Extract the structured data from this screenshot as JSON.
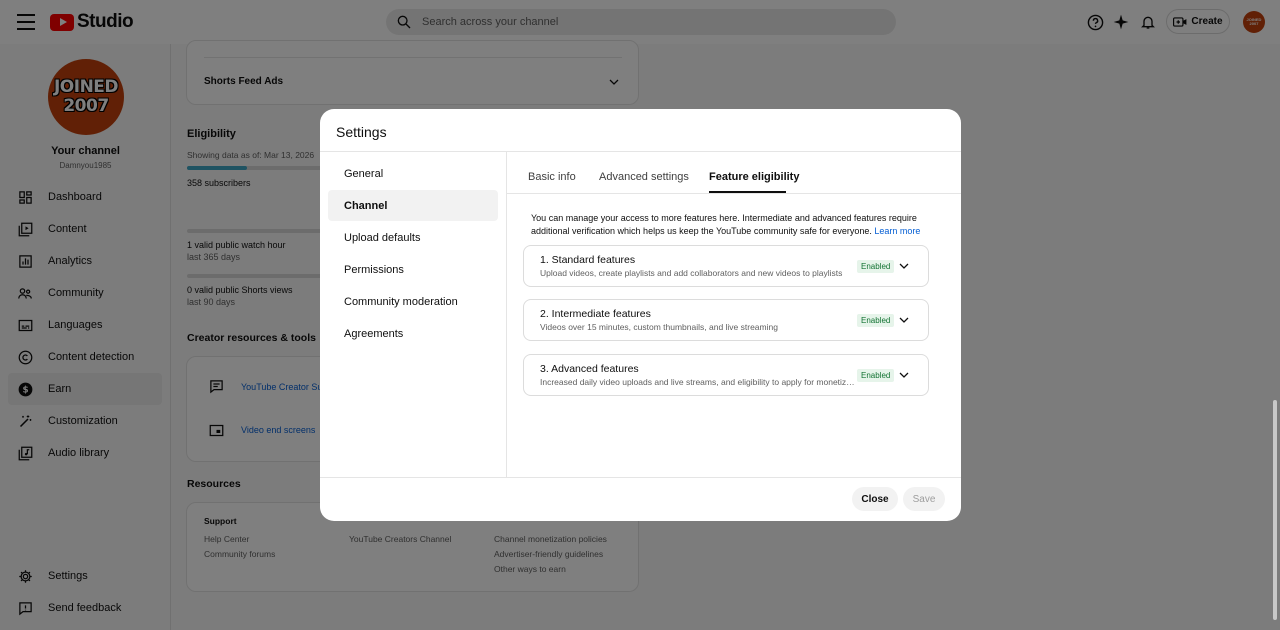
{
  "header": {
    "logo_text": "Studio",
    "search_placeholder": "Search across your channel",
    "create_label": "Create",
    "avatar_text": "JOINED 2007"
  },
  "sidebar": {
    "avatar_line1": "JOINED",
    "avatar_line2": "2007",
    "your_channel": "Your channel",
    "handle": "Damnyou1985",
    "items": [
      {
        "label": "Dashboard",
        "icon": "dashboard-icon"
      },
      {
        "label": "Content",
        "icon": "content-icon"
      },
      {
        "label": "Analytics",
        "icon": "analytics-icon"
      },
      {
        "label": "Community",
        "icon": "community-icon"
      },
      {
        "label": "Languages",
        "icon": "languages-icon"
      },
      {
        "label": "Content detection",
        "icon": "copyright-icon"
      },
      {
        "label": "Earn",
        "icon": "earn-icon"
      },
      {
        "label": "Customization",
        "icon": "customization-icon"
      },
      {
        "label": "Audio library",
        "icon": "audio-library-icon"
      }
    ],
    "bottom_items": [
      {
        "label": "Settings",
        "icon": "gear-icon"
      },
      {
        "label": "Send feedback",
        "icon": "feedback-icon"
      }
    ]
  },
  "background": {
    "shorts_feed_ads": "Shorts Feed Ads",
    "eligibility_title": "Eligibility",
    "showing_data": "Showing data as of: Mar 13, 2026",
    "subscribers": "358 subscribers",
    "subscribers_progress": 0.3,
    "watch_hours": "1 valid public watch hour",
    "watch_hours_period": "last 365 days",
    "shorts_views": "0 valid public Shorts views",
    "shorts_views_period": "last 90 days",
    "creator_resources_title": "Creator resources & tools",
    "creator_support": "YouTube Creator Sup",
    "video_end_screens": "Video end screens",
    "resources_title": "Resources",
    "support_title": "Support",
    "help_center": "Help Center",
    "community_forums": "Community forums",
    "creators_channel": "YouTube Creators Channel",
    "monetization_policies": "Channel monetization policies",
    "advertiser_guidelines": "Advertiser-friendly guidelines",
    "other_ways": "Other ways to earn"
  },
  "modal": {
    "title": "Settings",
    "nav": [
      {
        "label": "General",
        "active": false
      },
      {
        "label": "Channel",
        "active": true
      },
      {
        "label": "Upload defaults",
        "active": false
      },
      {
        "label": "Permissions",
        "active": false
      },
      {
        "label": "Community moderation",
        "active": false
      },
      {
        "label": "Agreements",
        "active": false
      }
    ],
    "tabs": [
      {
        "label": "Basic info",
        "active": false
      },
      {
        "label": "Advanced settings",
        "active": false
      },
      {
        "label": "Feature eligibility",
        "active": true
      }
    ],
    "description": "You can manage your access to more features here. Intermediate and advanced features require additional verification which helps us keep the YouTube community safe for everyone.",
    "learn_more": "Learn more",
    "features": [
      {
        "title": "1. Standard features",
        "subtitle": "Upload videos, create playlists and add collaborators and new videos to playlists",
        "status": "Enabled"
      },
      {
        "title": "2. Intermediate features",
        "subtitle": "Videos over 15 minutes, custom thumbnails, and live streaming",
        "status": "Enabled"
      },
      {
        "title": "3. Advanced features",
        "subtitle": "Increased daily video uploads and live streams, and eligibility to apply for monetization",
        "status": "Enabled"
      }
    ],
    "close_label": "Close",
    "save_label": "Save"
  },
  "colors": {
    "brand_red": "#ff0000",
    "avatar_orange": "#c2410c",
    "link_blue": "#065fd4",
    "enabled_green": "#137333",
    "enabled_bg": "#e6f4ea",
    "progress_teal": "#3ea6c5"
  }
}
